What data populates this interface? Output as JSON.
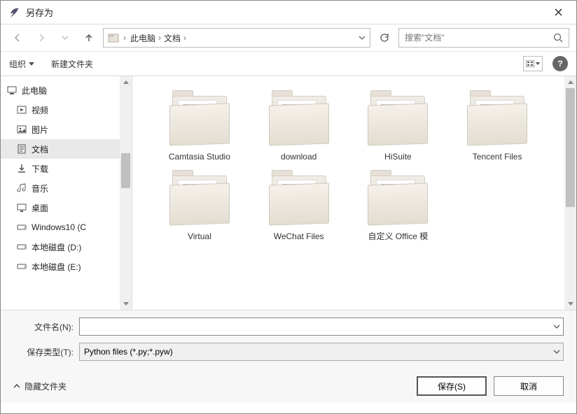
{
  "titlebar": {
    "title": "另存为"
  },
  "nav": {
    "crumbs": [
      "此电脑",
      "文档"
    ],
    "search_placeholder": "搜索\"文档\""
  },
  "toolbar": {
    "organize": "组织",
    "new_folder": "新建文件夹"
  },
  "tree": {
    "items": [
      {
        "label": "此电脑",
        "icon": "pc",
        "top": true
      },
      {
        "label": "视频",
        "icon": "video"
      },
      {
        "label": "图片",
        "icon": "picture"
      },
      {
        "label": "文档",
        "icon": "document",
        "selected": true
      },
      {
        "label": "下载",
        "icon": "download"
      },
      {
        "label": "音乐",
        "icon": "music"
      },
      {
        "label": "桌面",
        "icon": "desktop"
      },
      {
        "label": "Windows10 (C",
        "icon": "disk"
      },
      {
        "label": "本地磁盘 (D:)",
        "icon": "disk"
      },
      {
        "label": "本地磁盘 (E:)",
        "icon": "disk"
      }
    ]
  },
  "files": {
    "items": [
      {
        "label": "Camtasia Studio"
      },
      {
        "label": "download"
      },
      {
        "label": "HiSuite"
      },
      {
        "label": "Tencent Files"
      },
      {
        "label": "Virtual"
      },
      {
        "label": "WeChat Files"
      },
      {
        "label": "自定义 Office 模"
      },
      {
        "label": ""
      }
    ]
  },
  "form": {
    "filename_label": "文件名(N):",
    "filename_value": "",
    "type_label": "保存类型(T):",
    "type_value": "Python files (*.py;*.pyw)"
  },
  "footer": {
    "hide_folders": "隐藏文件夹",
    "save": "保存(S)",
    "cancel": "取消"
  }
}
